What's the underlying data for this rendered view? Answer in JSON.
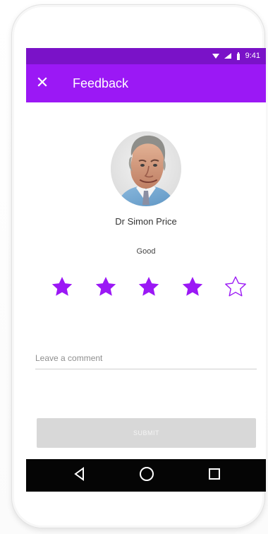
{
  "status_bar": {
    "time": "9:41",
    "icons": [
      "wifi-icon",
      "cellular-signal-icon",
      "battery-icon"
    ]
  },
  "app_bar": {
    "title": "Feedback",
    "close_icon": "close-icon"
  },
  "profile": {
    "name": "Dr Simon Price",
    "avatar_icon": "doctor-avatar"
  },
  "rating": {
    "label": "Good",
    "value": 4,
    "max": 5,
    "filled_glyph": "★",
    "empty_glyph": "☆"
  },
  "comment": {
    "placeholder": "Leave a comment",
    "value": ""
  },
  "submit": {
    "label": "SUBMIT"
  },
  "navigation": {
    "icons": [
      "back-triangle-icon",
      "home-circle-icon",
      "recents-square-icon"
    ]
  },
  "colors": {
    "status_bar": "#7a12c8",
    "app_bar": "#9b18f5",
    "accent": "#9b18f5",
    "submit_disabled": "#d8d8d8",
    "nav_bar": "#050505"
  }
}
